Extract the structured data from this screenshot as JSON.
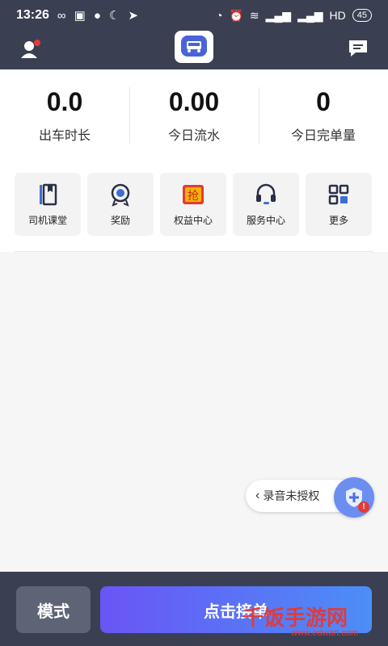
{
  "status_bar": {
    "time": "13:26",
    "battery": "45"
  },
  "stats": [
    {
      "value": "0.0",
      "label": "出车时长"
    },
    {
      "value": "0.00",
      "label": "今日流水"
    },
    {
      "value": "0",
      "label": "今日完单量"
    }
  ],
  "menu": [
    {
      "label": "司机课堂",
      "icon": "book-icon"
    },
    {
      "label": "奖励",
      "icon": "reward-icon"
    },
    {
      "label": "权益中心",
      "icon": "grab-icon"
    },
    {
      "label": "服务中心",
      "icon": "headset-icon"
    },
    {
      "label": "更多",
      "icon": "grid-icon"
    }
  ],
  "record_permission": {
    "text": "录音未授权"
  },
  "bottom": {
    "mode_label": "模式",
    "accept_label": "点击接单"
  },
  "watermark": {
    "text": "千饭手游网",
    "url": "www.edwart.com"
  },
  "colors": {
    "header_bg": "#3b3f52",
    "accent": "#6a55f5"
  }
}
